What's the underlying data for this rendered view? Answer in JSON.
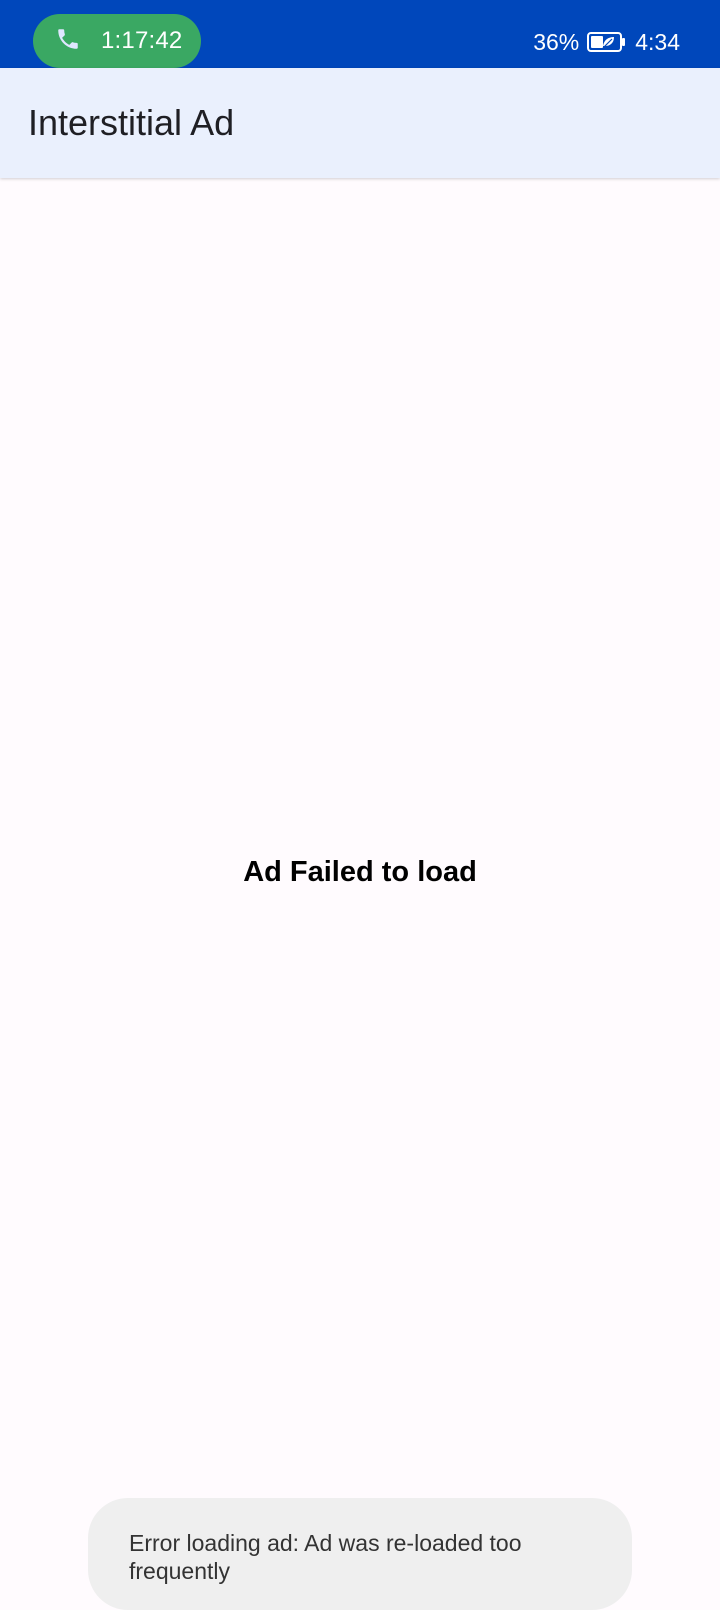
{
  "status_bar": {
    "call_timer": "1:17:42",
    "battery_percent": "36%",
    "clock": "4:34",
    "call_icon": "phone-icon",
    "battery_icon": "battery-saver-icon",
    "colors": {
      "background": "#0047bb",
      "call_pill": "#3aa863"
    }
  },
  "app_bar": {
    "title": "Interstitial Ad"
  },
  "main": {
    "status_message": "Ad Failed to load"
  },
  "toast": {
    "message": "Error loading ad: Ad was re-loaded too frequently"
  }
}
